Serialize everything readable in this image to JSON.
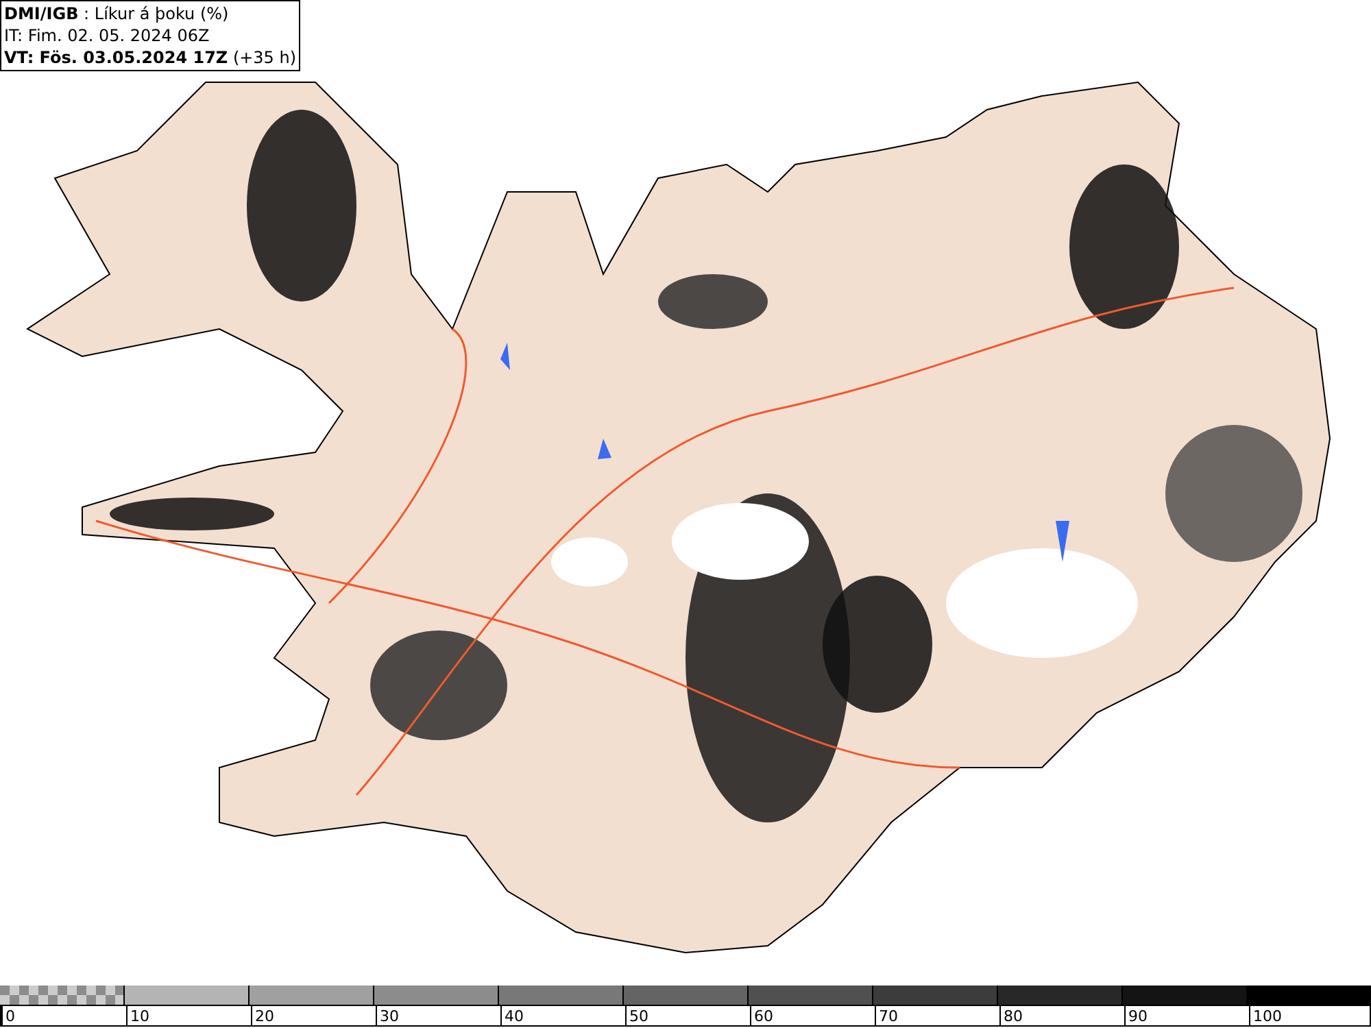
{
  "header": {
    "lines": [
      "**DMI/IGB** : Líkur á þoku (%)",
      "IT: Fim. 02. 05. 2024 06Z",
      "**VT: Fös. 03.05.2024 17Z** (+35 h)"
    ]
  },
  "legend": {
    "items": [
      {
        "kind": "checker",
        "color": "#8c8c8c",
        "label": "0"
      },
      {
        "kind": "solid",
        "color": "#b4b4b4",
        "label": "10"
      },
      {
        "kind": "solid",
        "color": "#a0a0a0",
        "label": "20"
      },
      {
        "kind": "solid",
        "color": "#8c8c8c",
        "label": "30"
      },
      {
        "kind": "solid",
        "color": "#787878",
        "label": "40"
      },
      {
        "kind": "solid",
        "color": "#646464",
        "label": "50"
      },
      {
        "kind": "solid",
        "color": "#505050",
        "label": "60"
      },
      {
        "kind": "solid",
        "color": "#3c3c3c",
        "label": "70"
      },
      {
        "kind": "solid",
        "color": "#282828",
        "label": "80"
      },
      {
        "kind": "solid",
        "color": "#141414",
        "label": "90"
      },
      {
        "kind": "solid",
        "color": "#000000",
        "label": "100"
      }
    ]
  }
}
